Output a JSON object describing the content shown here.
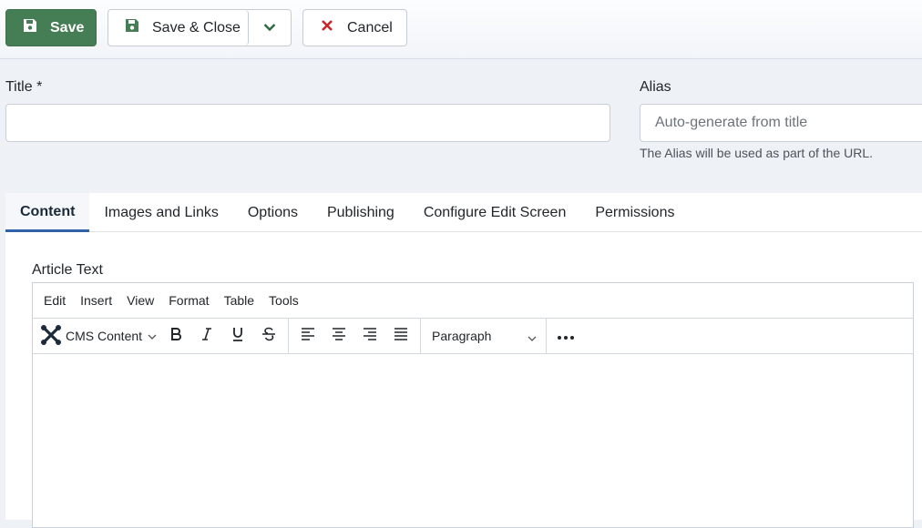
{
  "toolbar": {
    "save_label": "Save",
    "save_close_label": "Save & Close",
    "cancel_label": "Cancel"
  },
  "form": {
    "title_label": "Title *",
    "title_value": "",
    "alias_label": "Alias",
    "alias_placeholder": "Auto-generate from title",
    "alias_hint": "The Alias will be used as part of the URL."
  },
  "tabs": [
    {
      "label": "Content",
      "active": true
    },
    {
      "label": "Images and Links"
    },
    {
      "label": "Options"
    },
    {
      "label": "Publishing"
    },
    {
      "label": "Configure Edit Screen"
    },
    {
      "label": "Permissions"
    }
  ],
  "editor": {
    "label": "Article Text",
    "menu": [
      "Edit",
      "Insert",
      "View",
      "Format",
      "Table",
      "Tools"
    ],
    "cms_content_label": "CMS Content",
    "block_format": "Paragraph"
  },
  "colors": {
    "save_bg": "#457d54",
    "cancel_icon": "#c52827",
    "active_tab_border": "#2f62a8"
  }
}
